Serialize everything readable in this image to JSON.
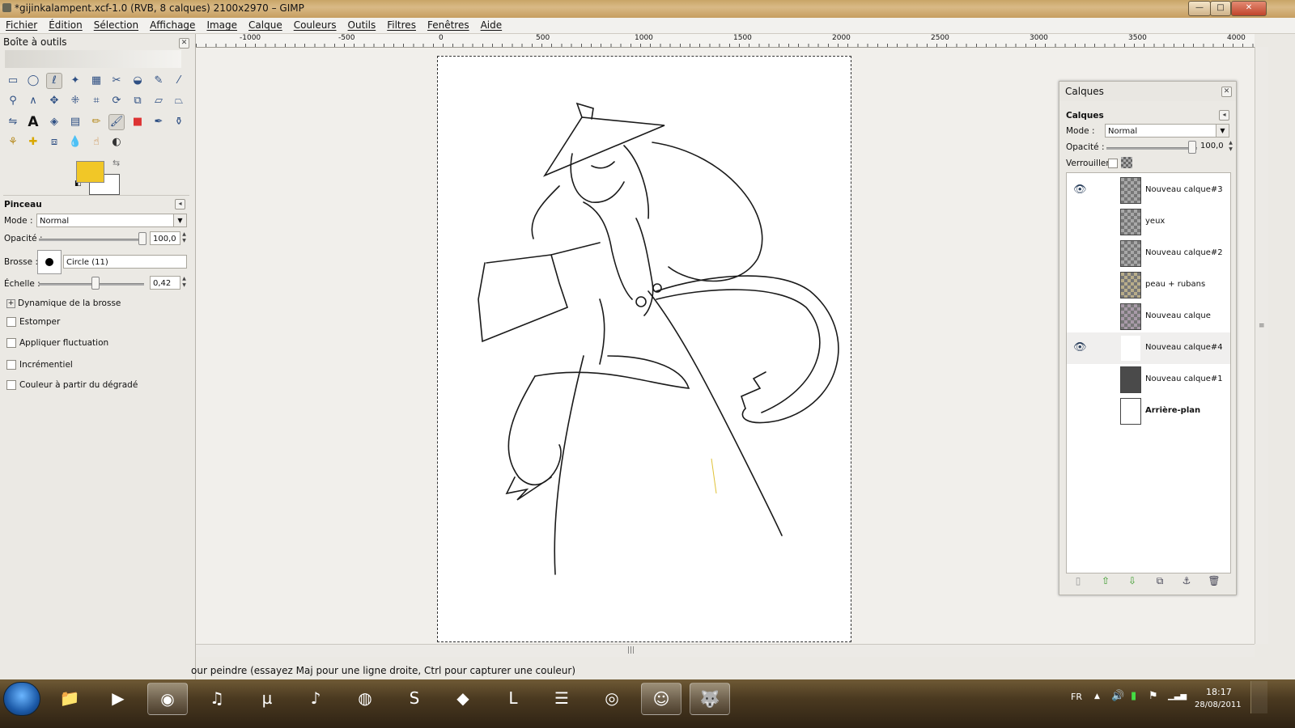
{
  "window": {
    "title": "*gijinkalampent.xcf-1.0 (RVB, 8 calques) 2100x2970 – GIMP",
    "minimize": "—",
    "maximize": "□",
    "close": "✕"
  },
  "menu": [
    "Fichier",
    "Édition",
    "Sélection",
    "Affichage",
    "Image",
    "Calque",
    "Couleurs",
    "Outils",
    "Filtres",
    "Fenêtres",
    "Aide"
  ],
  "toolbox": {
    "title": "Boîte à outils",
    "fg_color": "#f1c727",
    "bg_color": "#ffffff",
    "tool_options": {
      "title": "Pinceau",
      "mode_label": "Mode :",
      "mode_value": "Normal",
      "opacity_label": "Opacité :",
      "opacity_value": "100,0",
      "opacity": 1.0,
      "brush_label": "Brosse :",
      "brush_value": "Circle (11)",
      "scale_label": "Échelle :",
      "scale_value": "0,42",
      "dynamics_label": "Dynamique de la brosse",
      "checkboxes": [
        "Estomper",
        "Appliquer fluctuation",
        "Incrémentiel",
        "Couleur à partir du dégradé"
      ]
    }
  },
  "rulers": {
    "h_ticks": [
      "-1000",
      "-500",
      "0",
      "500",
      "1000",
      "1500",
      "2000",
      "2500",
      "3000",
      "3500",
      "4000"
    ]
  },
  "status_text": "our peindre (essayez Maj pour une ligne droite, Ctrl pour capturer une couleur)",
  "layers_panel": {
    "title": "Calques",
    "tab_label": "Calques",
    "mode_label": "Mode :",
    "mode_value": "Normal",
    "opacity_label": "Opacité :",
    "opacity_value": "100,0",
    "opacity": 1.0,
    "lock_label": "Verrouiller :",
    "layers": [
      {
        "name": "Nouveau calque#3",
        "visible": true
      },
      {
        "name": "yeux",
        "visible": false
      },
      {
        "name": "Nouveau calque#2",
        "visible": false
      },
      {
        "name": "peau + rubans",
        "visible": false
      },
      {
        "name": "Nouveau calque",
        "visible": false
      },
      {
        "name": "Nouveau calque#4",
        "visible": true
      },
      {
        "name": "Nouveau calque#1",
        "visible": false
      },
      {
        "name": "Arrière-plan",
        "visible": false
      }
    ]
  },
  "taskbar": {
    "lang": "FR",
    "time": "18:17",
    "date": "28/08/2011"
  }
}
